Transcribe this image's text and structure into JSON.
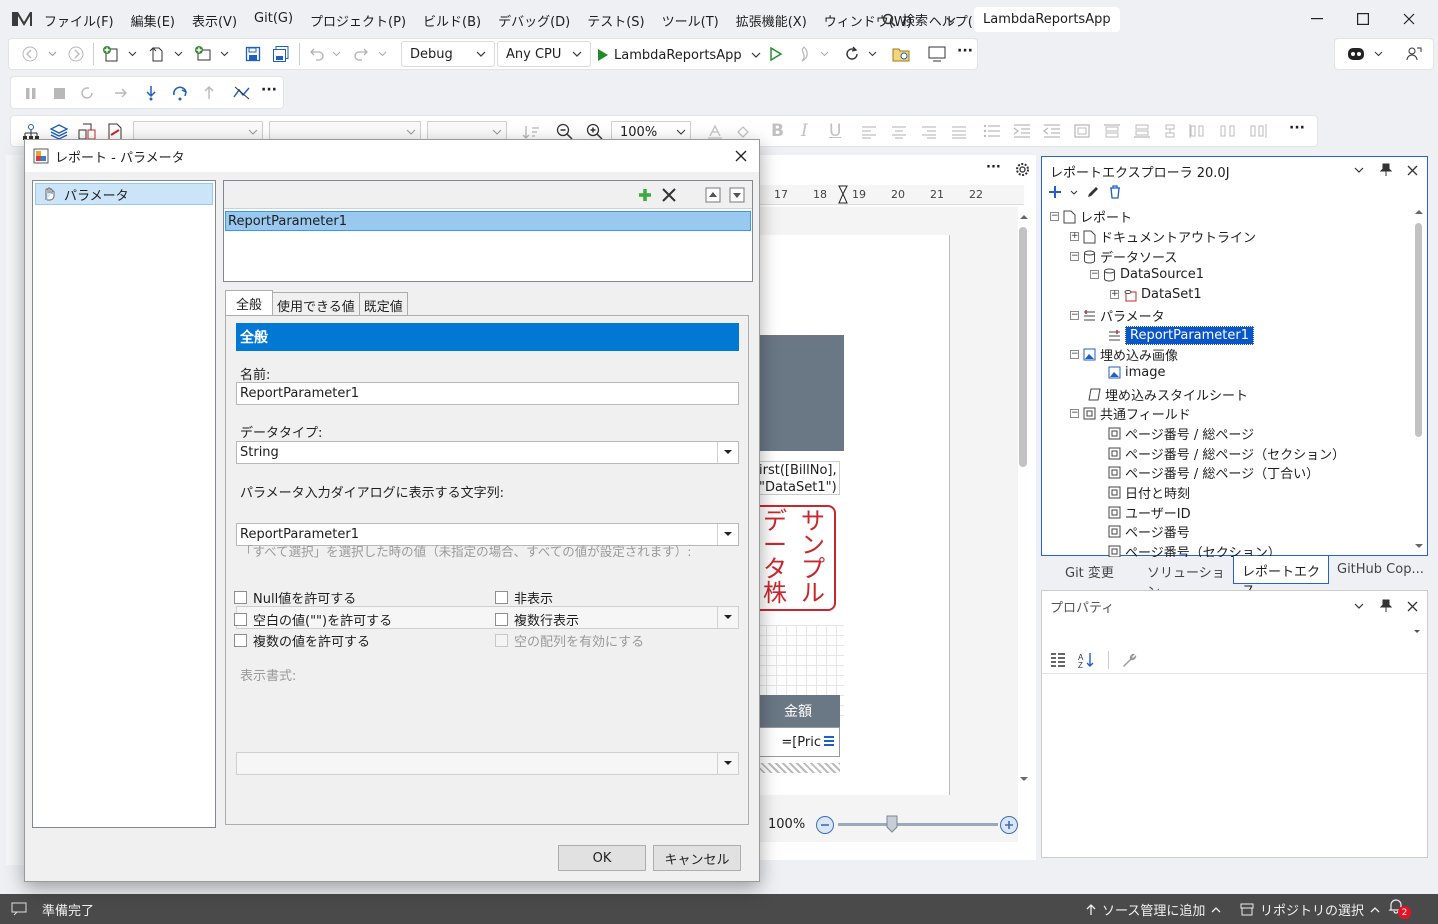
{
  "menu": [
    "ファイル(F)",
    "編集(E)",
    "表示(V)",
    "Git(G)",
    "プロジェクト(P)",
    "ビルド(B)",
    "デバッグ(D)",
    "テスト(S)",
    "ツール(T)",
    "拡張機能(X)",
    "ウィンドウ(W)",
    "ヘルプ(H)"
  ],
  "search_label": "検索",
  "solution_name": "LambdaReportsApp",
  "toolbar": {
    "config": "Debug",
    "platform": "Any CPU",
    "start_target": "LambdaReportsApp"
  },
  "format": {
    "zoom": "100%"
  },
  "designer": {
    "ruler": [
      "17",
      "18",
      "19",
      "20",
      "21",
      "22"
    ],
    "expr1": "irst([BillNo],",
    "expr2": "\"DataSet1\")",
    "stamp": [
      "サ",
      "デ",
      "ン",
      "ー",
      "プ",
      "タ",
      "ル",
      "株"
    ],
    "col_header": "金額",
    "col_value": "=[Pric",
    "zoom": "100%"
  },
  "dialog": {
    "title": "レポート - パラメータ",
    "nav_item": "パラメータ",
    "param_list": [
      "ReportParameter1"
    ],
    "tabs": [
      "全般",
      "使用できる値",
      "既定値"
    ],
    "section_header": "全般",
    "name_label": "名前:",
    "name_value": "ReportParameter1",
    "datatype_label": "データタイプ:",
    "datatype_value": "String",
    "prompt_label": "パラメータ入力ダイアログに表示する文字列:",
    "prompt_value": "ReportParameter1",
    "select_all_label": "「すべて選択」を選択した時の値（未指定の場合、すべての値が設定されます）:",
    "checks": [
      "Null値を許可する",
      "空白の値(\"\")を許可する",
      "複数の値を許可する",
      "非表示",
      "複数行表示",
      "空の配列を有効にする"
    ],
    "format_label": "表示書式:",
    "ok": "OK",
    "cancel": "キャンセル"
  },
  "explorer": {
    "title": "レポートエクスプローラ 20.0J",
    "tree": [
      "レポート",
      "ドキュメントアウトライン",
      "データソース",
      "DataSource1",
      "DataSet1",
      "パラメータ",
      "ReportParameter1",
      "埋め込み画像",
      "image",
      "埋め込みスタイルシート",
      "共通フィールド",
      "ページ番号 / 総ページ",
      "ページ番号 / 総ページ（セクション）",
      "ページ番号 / 総ページ（丁合い）",
      "日付と時刻",
      "ユーザーID",
      "ページ番号",
      "ページ番号（セクション）"
    ],
    "tabs": [
      "Git 変更",
      "ソリューション...",
      "レポートエクス...",
      "GitHub Cop..."
    ]
  },
  "properties": {
    "title": "プロパティ"
  },
  "status": {
    "ready": "準備完了",
    "source_control": "ソース管理に追加",
    "repo": "リポジトリの選択",
    "badge": "2"
  },
  "colors": {
    "accent": "#0078d4",
    "vs_purple": "#68217a",
    "stamp_red": "#c8282d",
    "header_gray": "#6a7885"
  }
}
